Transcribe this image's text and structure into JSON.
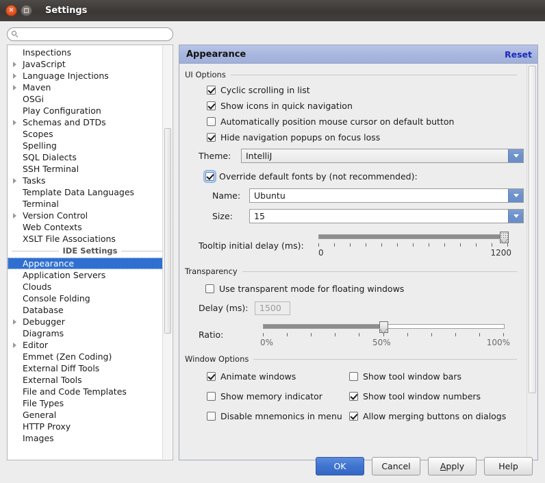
{
  "window": {
    "title": "Settings",
    "close_icon": "close-icon",
    "maximize_icon": "maximize-icon"
  },
  "search": {
    "placeholder": "",
    "value": "",
    "icon": "search-icon"
  },
  "sidebar": {
    "items": [
      {
        "label": "Inspections",
        "expandable": false
      },
      {
        "label": "JavaScript",
        "expandable": true
      },
      {
        "label": "Language Injections",
        "expandable": true
      },
      {
        "label": "Maven",
        "expandable": true
      },
      {
        "label": "OSGi",
        "expandable": false
      },
      {
        "label": "Play Configuration",
        "expandable": false
      },
      {
        "label": "Schemas and DTDs",
        "expandable": true
      },
      {
        "label": "Scopes",
        "expandable": false
      },
      {
        "label": "Spelling",
        "expandable": false
      },
      {
        "label": "SQL Dialects",
        "expandable": false
      },
      {
        "label": "SSH Terminal",
        "expandable": false
      },
      {
        "label": "Tasks",
        "expandable": true
      },
      {
        "label": "Template Data Languages",
        "expandable": false
      },
      {
        "label": "Terminal",
        "expandable": false
      },
      {
        "label": "Version Control",
        "expandable": true
      },
      {
        "label": "Web Contexts",
        "expandable": false
      },
      {
        "label": "XSLT File Associations",
        "expandable": false
      }
    ],
    "separator": "IDE Settings",
    "ide_items": [
      {
        "label": "Appearance",
        "expandable": false,
        "selected": true
      },
      {
        "label": "Application Servers",
        "expandable": false
      },
      {
        "label": "Clouds",
        "expandable": false
      },
      {
        "label": "Console Folding",
        "expandable": false
      },
      {
        "label": "Database",
        "expandable": false
      },
      {
        "label": "Debugger",
        "expandable": true
      },
      {
        "label": "Diagrams",
        "expandable": false
      },
      {
        "label": "Editor",
        "expandable": true
      },
      {
        "label": "Emmet (Zen Coding)",
        "expandable": false
      },
      {
        "label": "External Diff Tools",
        "expandable": false
      },
      {
        "label": "External Tools",
        "expandable": false
      },
      {
        "label": "File and Code Templates",
        "expandable": false
      },
      {
        "label": "File Types",
        "expandable": false
      },
      {
        "label": "General",
        "expandable": false
      },
      {
        "label": "HTTP Proxy",
        "expandable": false
      },
      {
        "label": "Images",
        "expandable": false
      }
    ]
  },
  "panel": {
    "title": "Appearance",
    "reset_label": "Reset",
    "ui_options": {
      "group_label": "UI Options",
      "checkboxes": [
        {
          "label": "Cyclic scrolling in list",
          "checked": true
        },
        {
          "label": "Show icons in quick navigation",
          "checked": true
        },
        {
          "label": "Automatically position mouse cursor on default button",
          "checked": false
        },
        {
          "label": "Hide navigation popups on focus loss",
          "checked": true
        }
      ],
      "theme": {
        "label": "Theme:",
        "value": "IntelliJ"
      },
      "override_fonts": {
        "label": "Override default fonts by (not recommended):",
        "checked": true,
        "focused": true
      },
      "font_name": {
        "label": "Name:",
        "value": "Ubuntu"
      },
      "font_size": {
        "label": "Size:",
        "value": "15"
      },
      "tooltip_delay": {
        "label": "Tooltip initial delay (ms):",
        "min_label": "0",
        "max_label": "1200",
        "value": 1200,
        "min": 0,
        "max": 1200,
        "tick_count": 13
      }
    },
    "transparency": {
      "group_label": "Transparency",
      "use_transparent": {
        "label": "Use transparent mode for floating windows",
        "checked": false
      },
      "delay": {
        "label": "Delay (ms):",
        "value": "1500",
        "disabled": true
      },
      "ratio": {
        "label": "Ratio:",
        "min_label": "0%",
        "mid_label": "50%",
        "max_label": "100%",
        "value": 50,
        "min": 0,
        "max": 100,
        "tick_count": 11
      }
    },
    "window_options": {
      "group_label": "Window Options",
      "rows": [
        {
          "left": {
            "label": "Animate windows",
            "checked": true
          },
          "right": {
            "label": "Show tool window bars",
            "checked": false
          }
        },
        {
          "left": {
            "label": "Show memory indicator",
            "checked": false
          },
          "right": {
            "label": "Show tool window numbers",
            "checked": true
          }
        },
        {
          "left": {
            "label": "Disable mnemonics in menu",
            "checked": false
          },
          "right": {
            "label": "Allow merging buttons on dialogs",
            "checked": true
          }
        }
      ]
    }
  },
  "buttons": {
    "ok": "OK",
    "cancel": "Cancel",
    "apply_prefix": "",
    "apply_mnemonic": "A",
    "apply_suffix": "pply",
    "help": "Help"
  },
  "colors": {
    "selection_blue": "#2f6fd0",
    "header_blue": "#a9b7df",
    "reset_link": "#1a29b8",
    "primary_button": "#3f74cf",
    "combo_arrow": "#6d91cb"
  }
}
